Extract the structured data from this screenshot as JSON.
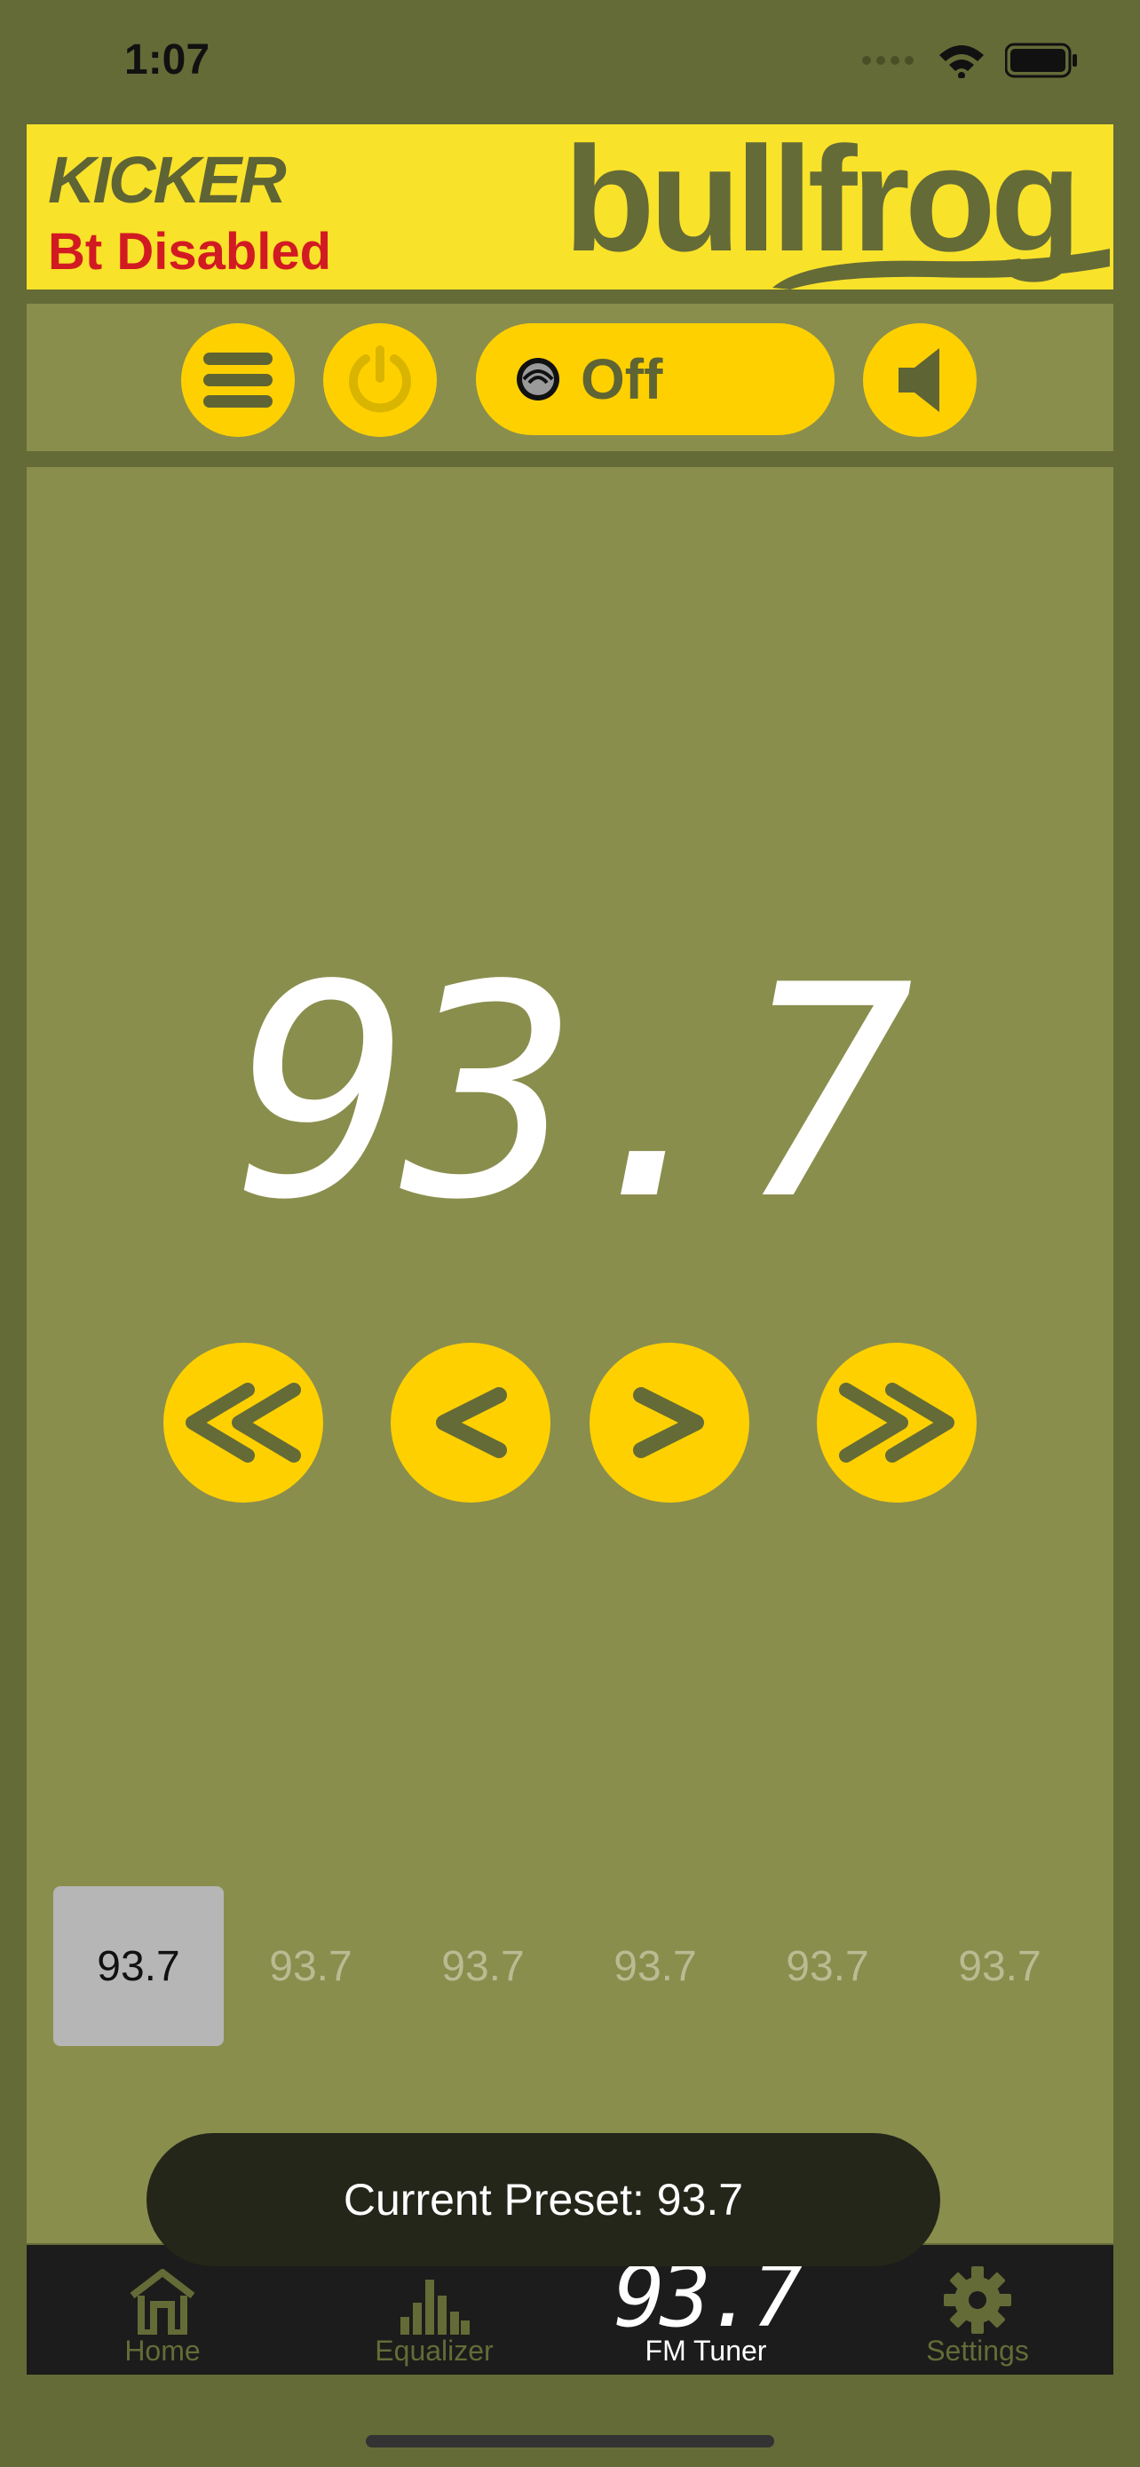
{
  "status_bar": {
    "time": "1:07"
  },
  "header": {
    "brand": "KICKER",
    "bt_status": "Bt Disabled",
    "product_logo": "bullfrog"
  },
  "controls": {
    "menu_icon": "hamburger-icon",
    "power_icon": "power-icon",
    "source_icon": "radio-source-icon",
    "source_label": "Off",
    "volume_icon": "speaker-icon"
  },
  "tuner": {
    "frequency": "93.7",
    "buttons": {
      "seek_back": "seek-back-icon",
      "step_back": "step-back-icon",
      "step_forward": "step-forward-icon",
      "seek_forward": "seek-forward-icon"
    }
  },
  "presets": [
    {
      "label": "93.7",
      "selected": true
    },
    {
      "label": "93.7",
      "selected": false
    },
    {
      "label": "93.7",
      "selected": false
    },
    {
      "label": "93.7",
      "selected": false
    },
    {
      "label": "93.7",
      "selected": false
    },
    {
      "label": "93.7",
      "selected": false
    }
  ],
  "toast": {
    "text": "Current Preset: 93.7"
  },
  "tabs": [
    {
      "label": "Home",
      "icon": "home-icon",
      "active": false
    },
    {
      "label": "Equalizer",
      "icon": "equalizer-icon",
      "active": false
    },
    {
      "label": "FM Tuner",
      "icon": "93.7",
      "active": true
    },
    {
      "label": "Settings",
      "icon": "gear-icon",
      "active": false
    }
  ],
  "colors": {
    "accent_yellow": "#ffd000",
    "banner_yellow": "#f9e22a",
    "olive_dark": "#646b37",
    "olive_panel": "#8a8e4d",
    "bt_red": "#d21a23"
  }
}
